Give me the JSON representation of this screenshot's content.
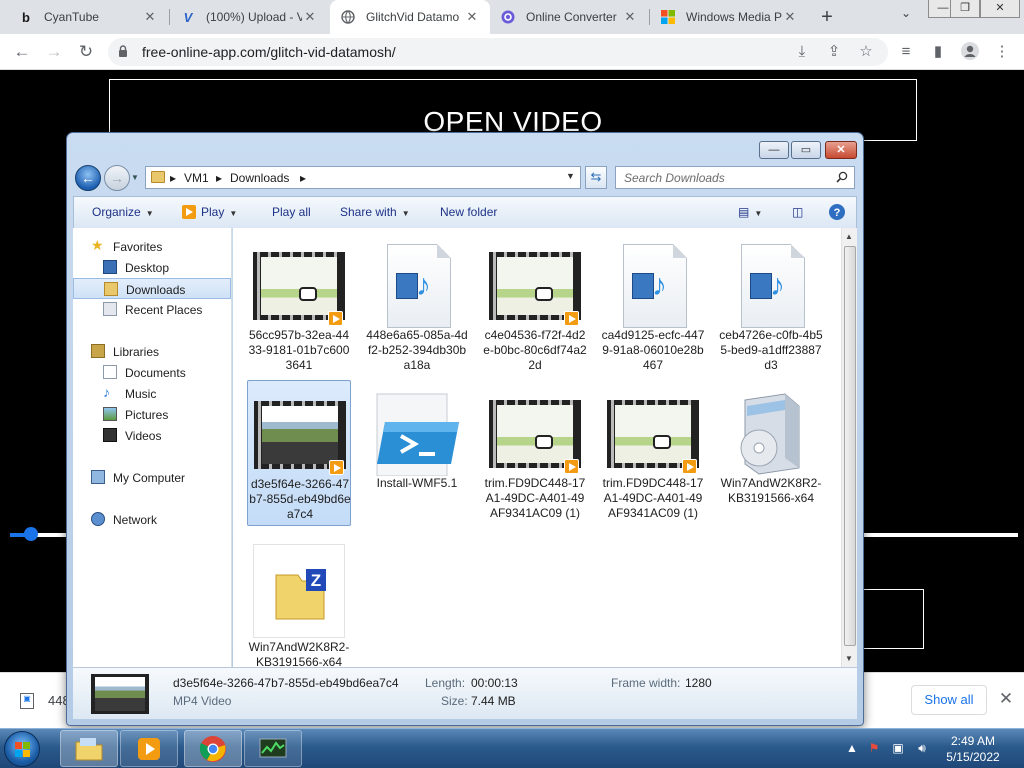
{
  "browser": {
    "tabs": [
      {
        "title": "CyanTube",
        "icon": "b"
      },
      {
        "title": "(100%) Upload - V",
        "icon": "V"
      },
      {
        "title": "GlitchVid Datamo",
        "icon": "globe"
      },
      {
        "title": "Online Converter",
        "icon": "converter"
      },
      {
        "title": "Windows Media P",
        "icon": "windows"
      }
    ],
    "new_tab": "+",
    "tab_close": "✕",
    "url": "free-online-app.com/glitch-vid-datamosh/"
  },
  "page": {
    "open_video_label": "OPEN VIDEO"
  },
  "explorer": {
    "breadcrumb": [
      "VM1",
      "Downloads"
    ],
    "search_placeholder": "Search Downloads",
    "toolbar": {
      "organize": "Organize",
      "play": "Play",
      "play_all": "Play all",
      "share_with": "Share with",
      "new_folder": "New folder"
    },
    "nav": {
      "favorites": "Favorites",
      "desktop": "Desktop",
      "downloads": "Downloads",
      "recent_places": "Recent Places",
      "libraries": "Libraries",
      "documents": "Documents",
      "music": "Music",
      "pictures": "Pictures",
      "videos": "Videos",
      "my_computer": "My Computer",
      "network": "Network"
    },
    "files": [
      {
        "name": "56cc957b-32ea-4433-9181-01b7c6003641",
        "type": "video"
      },
      {
        "name": "448e6a65-085a-4df2-b252-394db30ba18a",
        "type": "media"
      },
      {
        "name": "c4e04536-f72f-4d2e-b0bc-80c6df74a22d",
        "type": "video"
      },
      {
        "name": "ca4d9125-ecfc-4479-91a8-06010e28b467",
        "type": "media"
      },
      {
        "name": "ceb4726e-c0fb-4b55-bed9-a1dff23887d3",
        "type": "media"
      },
      {
        "name": "d3e5f64e-3266-47b7-855d-eb49bd6ea7c4",
        "type": "video",
        "selected": true
      },
      {
        "name": "Install-WMF5.1",
        "type": "powershell"
      },
      {
        "name": "trim.FD9DC448-17A1-49DC-A401-49AF9341AC09 (1)",
        "type": "video"
      },
      {
        "name": "trim.FD9DC448-17A1-49DC-A401-49AF9341AC09 (1)",
        "type": "video"
      },
      {
        "name": "Win7AndW2K8R2-KB3191566-x64",
        "type": "installer"
      },
      {
        "name": "Win7AndW2K8R2-KB3191566-x64",
        "type": "zip"
      }
    ],
    "details": {
      "name": "d3e5f64e-3266-47b7-855d-eb49bd6ea7c4",
      "kind": "MP4 Video",
      "length_label": "Length:",
      "length": "00:00:13",
      "size_label": "Size:",
      "size": "7.44 MB",
      "frame_width_label": "Frame width:",
      "frame_width": "1280"
    }
  },
  "shelf": {
    "file_partial": "448",
    "show_all": "Show all"
  },
  "taskbar": {
    "time": "2:49 AM",
    "date": "5/15/2022"
  },
  "colors": {
    "chrome_blue": "#1a73e8",
    "win7_accent": "#2b5a8c"
  }
}
